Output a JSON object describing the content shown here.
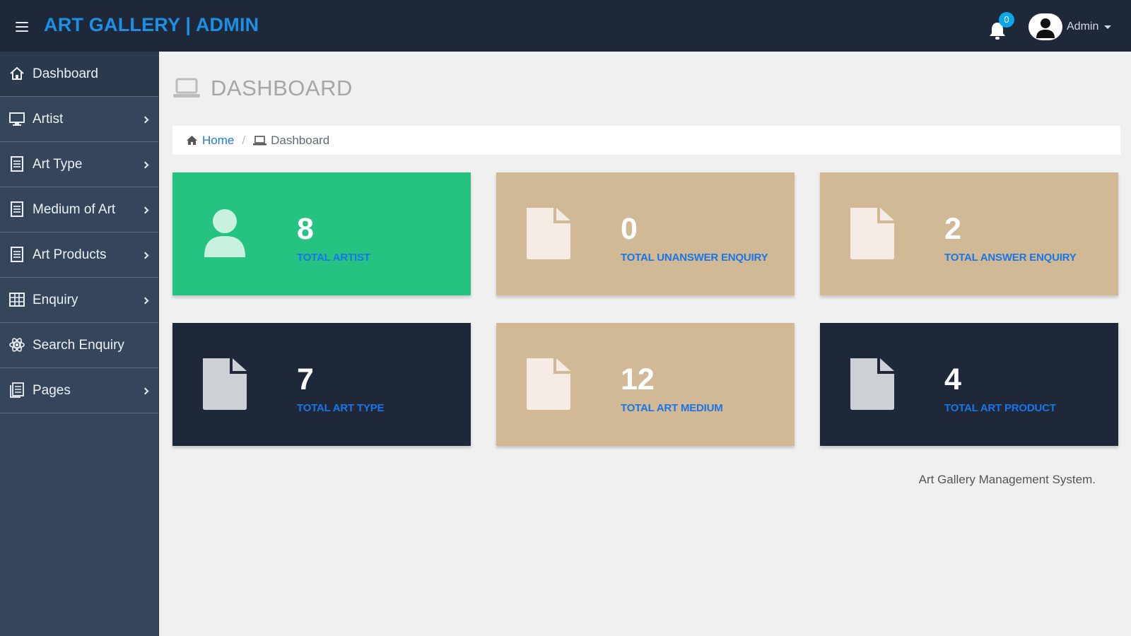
{
  "header": {
    "brand": "ART GALLERY | ADMIN",
    "notification_count": "0",
    "user_name": "Admin"
  },
  "sidebar": {
    "items": [
      {
        "label": "Dashboard",
        "icon": "home-icon"
      },
      {
        "label": "Artist",
        "icon": "monitor-icon"
      },
      {
        "label": "Art Type",
        "icon": "document-icon"
      },
      {
        "label": "Medium of Art",
        "icon": "document-icon"
      },
      {
        "label": "Art Products",
        "icon": "document-icon"
      },
      {
        "label": "Enquiry",
        "icon": "table-icon"
      },
      {
        "label": "Search Enquiry",
        "icon": "atom-icon"
      },
      {
        "label": "Pages",
        "icon": "pages-icon"
      }
    ]
  },
  "main": {
    "title": "DASHBOARD",
    "breadcrumb": {
      "home": "Home",
      "current": "Dashboard"
    },
    "cards": [
      {
        "value": "8",
        "label": "TOTAL ARTIST",
        "color": "#26c281",
        "icon": "user-icon"
      },
      {
        "value": "0",
        "label": "TOTAL UNANSWER ENQUIRY",
        "color": "#d2b996",
        "icon": "file-icon"
      },
      {
        "value": "2",
        "label": "TOTAL ANSWER ENQUIRY",
        "color": "#d2b996",
        "icon": "file-icon"
      },
      {
        "value": "7",
        "label": "TOTAL ART TYPE",
        "color": "#1e2838",
        "icon": "file-icon"
      },
      {
        "value": "12",
        "label": "TOTAL ART MEDIUM",
        "color": "#d2b996",
        "icon": "file-icon"
      },
      {
        "value": "4",
        "label": "TOTAL ART PRODUCT",
        "color": "#1e2838",
        "icon": "file-icon"
      }
    ],
    "footer": "Art Gallery Management System."
  }
}
